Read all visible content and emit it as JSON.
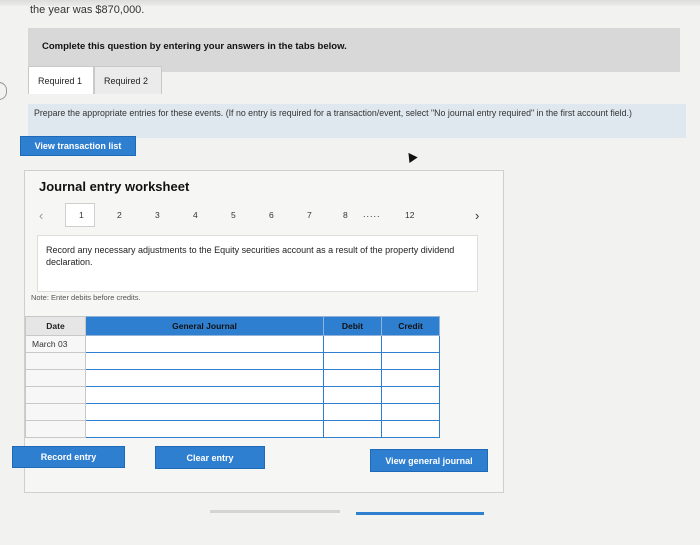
{
  "top_text": "the year was $870,000.",
  "instruction": "Complete this question by entering your answers in the tabs below.",
  "tabs": [
    {
      "label": "Required 1"
    },
    {
      "label": "Required 2"
    }
  ],
  "prepare_text": "Prepare the appropriate entries for these events. (If no entry is required for a transaction/event, select \"No journal entry required\" in the first account field.)",
  "view_transaction_label": "View transaction list",
  "worksheet": {
    "title": "Journal entry worksheet",
    "pages": [
      "1",
      "2",
      "3",
      "4",
      "5",
      "6",
      "7",
      "8"
    ],
    "ellipsis": ".....",
    "last_page": "12",
    "description": "Record any necessary adjustments to the Equity securities account as a result of the property dividend declaration.",
    "note": "Note: Enter debits before credits.",
    "table": {
      "headers": {
        "date": "Date",
        "account": "General Journal",
        "debit": "Debit",
        "credit": "Credit"
      },
      "first_date": "March 03"
    }
  },
  "buttons": {
    "record": "Record entry",
    "clear": "Clear entry",
    "view_journal": "View general journal"
  },
  "colors": {
    "accent": "#2f7fd1",
    "instruction_bg": "#d8d8d8",
    "prepare_bg": "#dfe8ee"
  }
}
